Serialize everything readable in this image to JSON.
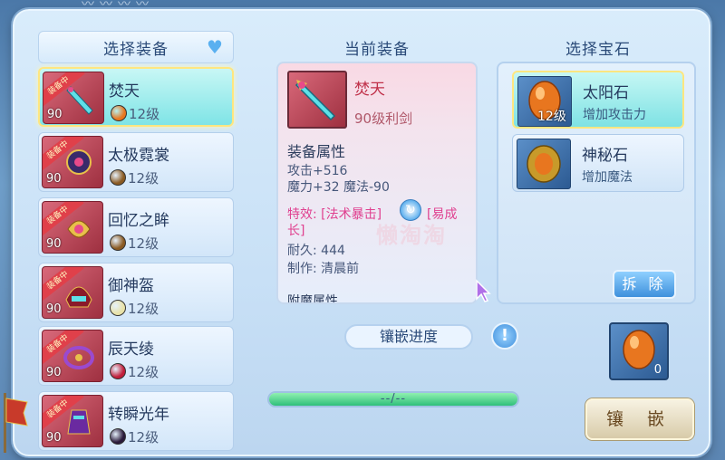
{
  "left_panel": {
    "title": "选择装备",
    "items": [
      {
        "name": "焚天",
        "level": "90",
        "badge": "装备中",
        "gem_level": "12级",
        "gem_color": "#e8761f",
        "selected": true
      },
      {
        "name": "太极霓裳",
        "level": "90",
        "badge": "装备中",
        "gem_level": "12级",
        "gem_color": "#8a5a22",
        "selected": false
      },
      {
        "name": "回忆之眸",
        "level": "90",
        "badge": "装备中",
        "gem_level": "12级",
        "gem_color": "#8a5a22",
        "selected": false
      },
      {
        "name": "御神盔",
        "level": "90",
        "badge": "装备中",
        "gem_level": "12级",
        "gem_color": "#e8e2a8",
        "selected": false
      },
      {
        "name": "辰天绫",
        "level": "90",
        "badge": "装备中",
        "gem_level": "12级",
        "gem_color": "#c01e3a",
        "selected": false
      },
      {
        "name": "转瞬光年",
        "level": "90",
        "badge": "装备中",
        "gem_level": "12级",
        "gem_color": "#2a1a3a",
        "selected": false
      }
    ]
  },
  "middle": {
    "title": "当前装备",
    "equip_name": "焚天",
    "equip_sub": "90级利剑",
    "attr_title": "装备属性",
    "attrs": [
      "攻击+516",
      "魔力+32 魔法-90"
    ],
    "special": "特效: [法术暴击]",
    "special_suffix": "[易成",
    "special_line2": "长]",
    "durability": "耐久: 444",
    "maker": "制作: 清晨前",
    "cut_line": "附魔属性",
    "watermark": "懒淘淘",
    "progress_label": "镶嵌进度",
    "progress_text": "--/--",
    "progress_fill": 1.0
  },
  "right_panel": {
    "title": "选择宝石",
    "stones": [
      {
        "name": "太阳石",
        "desc": "增加攻击力",
        "level": "12级",
        "color": "#e8761f",
        "selected": true
      },
      {
        "name": "神秘石",
        "desc": "增加魔法",
        "level": "",
        "color": "#c89a2a",
        "selected": false
      }
    ],
    "remove_label": "拆 除",
    "slot_count": "0",
    "embed_label": "镶 嵌"
  },
  "icons": {
    "help": "!",
    "refresh": "↻"
  }
}
